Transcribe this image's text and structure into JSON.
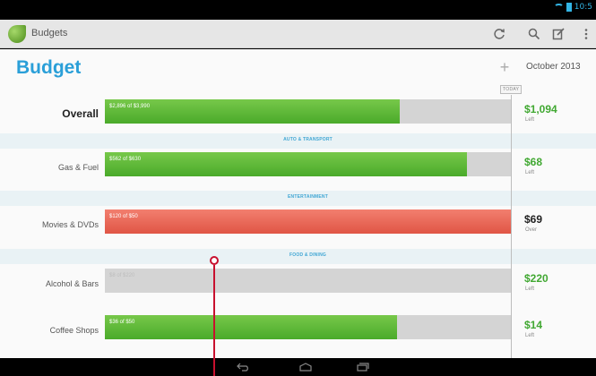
{
  "status_bar": {
    "time": "10:5"
  },
  "app": {
    "title": "Budgets"
  },
  "action_bar": {
    "icons": [
      "refresh-icon",
      "search-icon",
      "edit-icon",
      "overflow-menu-icon"
    ]
  },
  "page": {
    "title": "Budget",
    "add_label": "+",
    "month": "October 2013",
    "today_marker": "TODAY"
  },
  "overall": {
    "label": "Overall",
    "bar_text": "$2,896 of $3,990",
    "progress": 0.7258,
    "amount": "$1,094",
    "status": "Left"
  },
  "sections": [
    {
      "header": "AUTO & TRANSPORT",
      "items": [
        {
          "label": "Gas & Fuel",
          "bar_text": "$562 of $630",
          "progress": 0.892,
          "amount": "$68",
          "status": "Left"
        }
      ]
    },
    {
      "header": "ENTERTAINMENT",
      "items": [
        {
          "label": "Movies & DVDs",
          "bar_text": "$120 of $50",
          "progress": 1.0,
          "amount": "$69",
          "status": "Over"
        }
      ]
    },
    {
      "header": "FOOD & DINING",
      "items": [
        {
          "label": "Alcohol & Bars",
          "bar_text": "$8 of $220",
          "progress": 0.0,
          "amount": "$220",
          "status": "Left"
        },
        {
          "label": "Coffee Shops",
          "bar_text": "$36 of $50",
          "progress": 0.72,
          "amount": "$14",
          "status": "Left"
        }
      ]
    }
  ],
  "colors": {
    "accent": "#2a9fd8",
    "under_budget": "#41a832",
    "over_budget": "#e05545",
    "annotation": "#c8102e"
  }
}
